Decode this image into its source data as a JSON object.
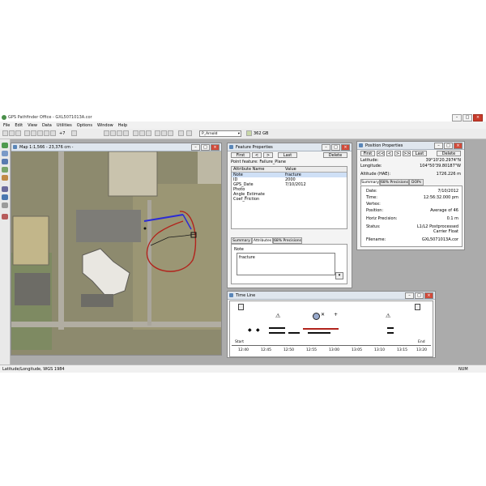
{
  "app": {
    "title": "GPS Pathfinder Office - GXL5071013A.cor",
    "menu": [
      "File",
      "Edit",
      "View",
      "Data",
      "Utilities",
      "Options",
      "Window",
      "Help"
    ],
    "zoom_label": "+7",
    "user_dropdown": "P_Arnold",
    "disk_space": "362 GB",
    "status_left": "Latitude/Longitude, WGS 1984",
    "status_right": "NUM"
  },
  "map_window": {
    "title": "Map 1:1,566 - 23,376 cm -"
  },
  "feature_window": {
    "title": "Feature Properties",
    "buttons": {
      "first": "First",
      "prev": "<",
      "next": ">",
      "last": "Last",
      "delete": "Delete"
    },
    "point_feature": "Point feature: Failure_Plane",
    "columns": [
      "Attribute Name",
      "Value"
    ],
    "rows": [
      {
        "name": "Note",
        "value": "fracture"
      },
      {
        "name": "ID",
        "value": "2000"
      },
      {
        "name": "GPS_Date",
        "value": "7/10/2012"
      },
      {
        "name": "Photo",
        "value": ""
      },
      {
        "name": "Angle_Estimate",
        "value": ""
      },
      {
        "name": "Coef_Friction",
        "value": ""
      }
    ],
    "tabs": [
      "Summary",
      "Attributes",
      "68% Precisions"
    ],
    "field_label": "Note",
    "field_value": "fracture"
  },
  "position_window": {
    "title": "Position Properties",
    "buttons": {
      "first": "First",
      "first_prev": "<<",
      "prev": "<",
      "next": ">",
      "next_next": ">>",
      "last": "Last",
      "delete": "Delete"
    },
    "latitude_label": "Latitude:",
    "latitude_value": "39°10'20.2974\"N",
    "longitude_label": "Longitude:",
    "longitude_value": "104°50'39.80187\"W",
    "altitude_label": "Altitude (HAE):",
    "altitude_value": "1726.226 m",
    "tabs": [
      "Summary",
      "68% Precisions",
      "DOPs"
    ],
    "rows": [
      {
        "label": "Date:",
        "value": "7/10/2012"
      },
      {
        "label": "Time:",
        "value": "12:56:32.000 pm"
      },
      {
        "label": "Vertex:",
        "value": ""
      },
      {
        "label": "Position:",
        "value": "Average of 46"
      },
      {
        "label": "Horiz Precision:",
        "value": "0.1 m"
      },
      {
        "label": "Status:",
        "value": "L1/L2 Postprocessed Carrier Float"
      },
      {
        "label": "Filename:",
        "value": "GXL5071013A.cor"
      }
    ]
  },
  "timeline_window": {
    "title": "Time Line",
    "start_label": "Start",
    "end_label": "End",
    "ticks": [
      "12:40",
      "12:45",
      "12:50",
      "12:55",
      "13:00",
      "13:05",
      "13:10",
      "13:15",
      "13:20"
    ]
  },
  "colors": {
    "accent": "#4a6fa5",
    "trail": "#b2231c",
    "line_blue": "#2b2bd6"
  }
}
